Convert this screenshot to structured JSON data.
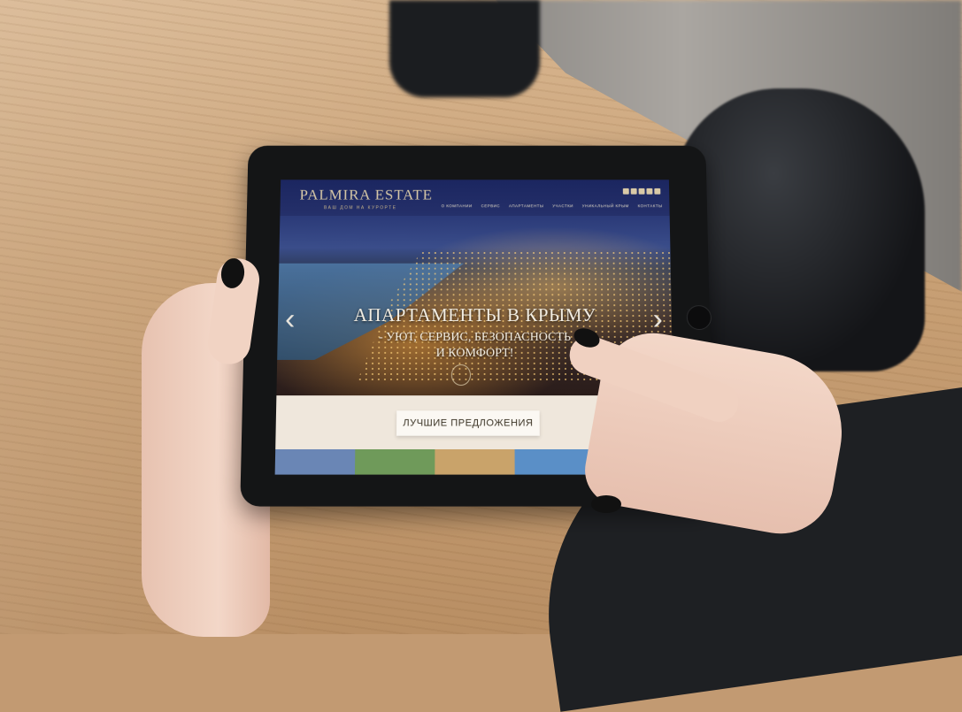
{
  "site": {
    "logo": "PALMIRA ESTATE",
    "tagline": "ВАШ ДОМ НА КУРОРТЕ",
    "nav": [
      "О КОМПАНИИ",
      "СЕРВИС",
      "АПАРТАМЕНТЫ",
      "УЧАСТКИ",
      "УНИКАЛЬНЫЙ КРЫМ",
      "КОНТАКТЫ"
    ],
    "hero": {
      "title": "АПАРТАМЕНТЫ В КРЫМУ",
      "subtitle_line1": "- УЮТ, СЕРВИС, БЕЗОПАСНОСТЬ",
      "subtitle_line2": "И КОМФОРТ!"
    },
    "offers_button": "ЛУЧШИЕ ПРЕДЛОЖЕНИЯ"
  },
  "colors": {
    "header": "#1b2660",
    "gold": "#d8c9a7",
    "table": "#c79f74",
    "tablet": "#141516"
  }
}
